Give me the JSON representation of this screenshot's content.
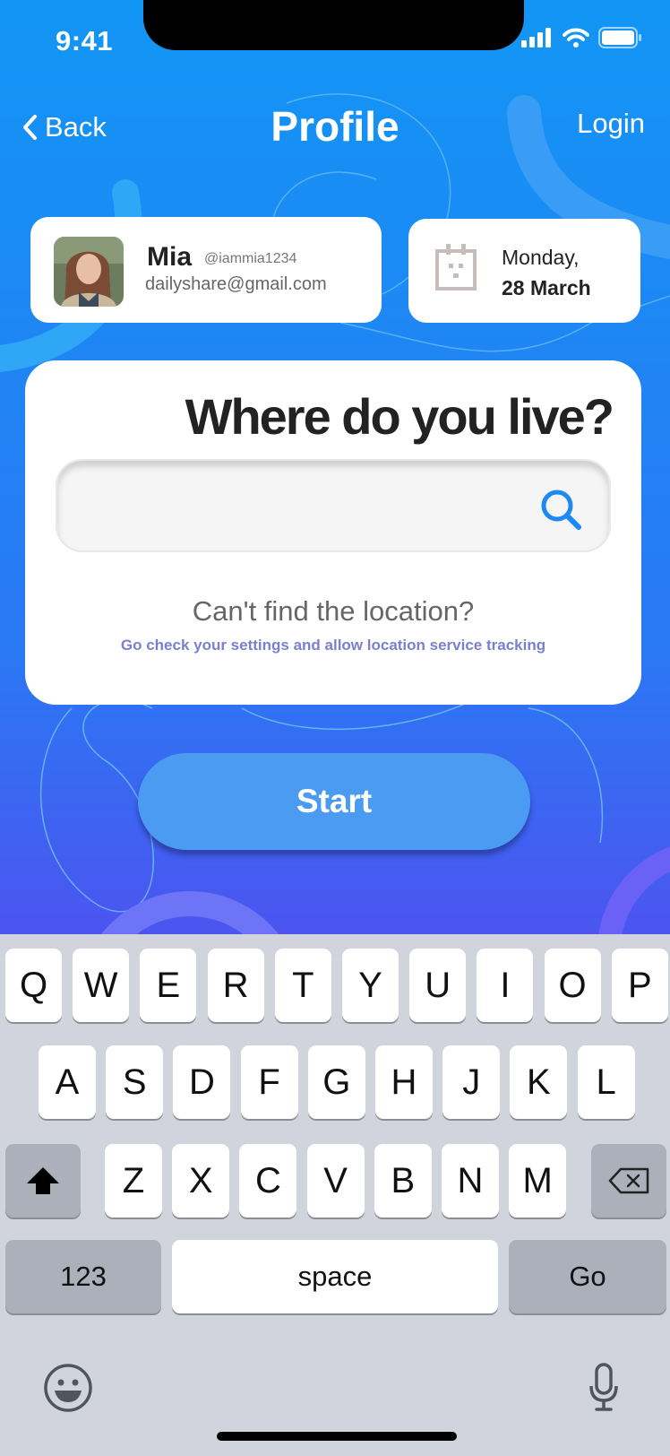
{
  "status_bar": {
    "time": "9:41"
  },
  "header": {
    "back_label": "Back",
    "title": "Profile",
    "login_label": "Login"
  },
  "user": {
    "name": "Mia",
    "handle": "@iammia1234",
    "email": "dailyshare@gmail.com"
  },
  "date": {
    "line1": "Monday,",
    "line2": "28 March"
  },
  "location": {
    "question": "Where do you live?",
    "search_value": "",
    "cant_find": "Can't find the location?",
    "hint": "Go check your settings and allow location service tracking"
  },
  "start_label": "Start",
  "keyboard": {
    "row1": [
      "Q",
      "W",
      "E",
      "R",
      "T",
      "Y",
      "U",
      "I",
      "O",
      "P"
    ],
    "row2": [
      "A",
      "S",
      "D",
      "F",
      "G",
      "H",
      "J",
      "K",
      "L"
    ],
    "row3": [
      "Z",
      "X",
      "C",
      "V",
      "B",
      "N",
      "M"
    ],
    "numbers_label": "123",
    "space_label": "space",
    "go_label": "Go"
  },
  "colors": {
    "accent": "#1e88f5",
    "button": "#4a9bf1",
    "hint": "#7b7fd0"
  }
}
